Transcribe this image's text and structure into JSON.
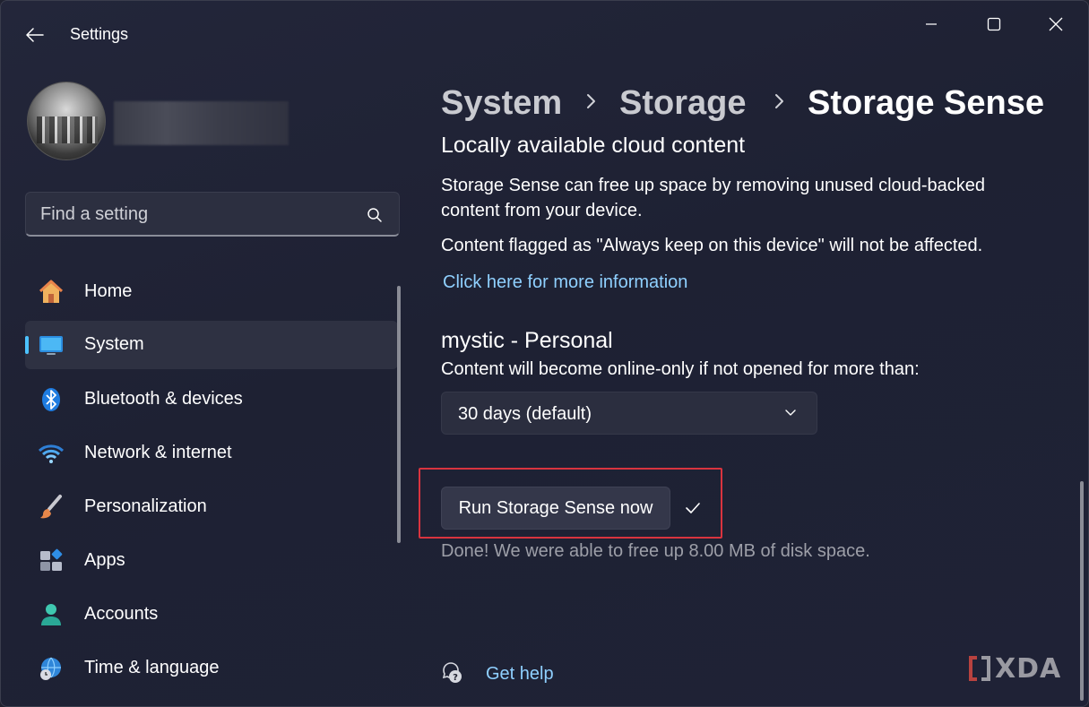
{
  "window": {
    "app_title": "Settings",
    "controls": {
      "minimize": "minimize",
      "maximize": "maximize",
      "close": "close"
    }
  },
  "search": {
    "placeholder": "Find a setting",
    "value": ""
  },
  "sidebar": {
    "items": [
      {
        "label": "Home",
        "icon": "home-icon",
        "selected": false
      },
      {
        "label": "System",
        "icon": "monitor-icon",
        "selected": true
      },
      {
        "label": "Bluetooth & devices",
        "icon": "bluetooth-icon",
        "selected": false
      },
      {
        "label": "Network & internet",
        "icon": "wifi-icon",
        "selected": false
      },
      {
        "label": "Personalization",
        "icon": "brush-icon",
        "selected": false
      },
      {
        "label": "Apps",
        "icon": "apps-icon",
        "selected": false
      },
      {
        "label": "Accounts",
        "icon": "person-icon",
        "selected": false
      },
      {
        "label": "Time & language",
        "icon": "globe-clock-icon",
        "selected": false
      }
    ]
  },
  "breadcrumb": {
    "items": [
      "System",
      "Storage",
      "Storage Sense"
    ],
    "separator": "›"
  },
  "content": {
    "cloud_title": "Locally available cloud content",
    "cloud_desc_line1": "Storage Sense can free up space by removing unused cloud-backed",
    "cloud_desc_line2": "content from your device.",
    "flagged_note": "Content flagged as \"Always keep on this device\" will not be affected.",
    "more_info_link": "Click here for more information",
    "account_title": "mystic - Personal",
    "online_only_label": "Content will become online-only if not opened for more than:",
    "online_only_value": "30 days (default)",
    "run_button": "Run Storage Sense now",
    "done_message": "Done! We were able to free up 8.00 MB of disk space.",
    "get_help": "Get help"
  },
  "watermark": {
    "text": "XDA"
  },
  "colors": {
    "accent": "#4cc2ff",
    "link": "#8fd0ff",
    "highlight_box": "#d9343f",
    "background": "#202230"
  }
}
